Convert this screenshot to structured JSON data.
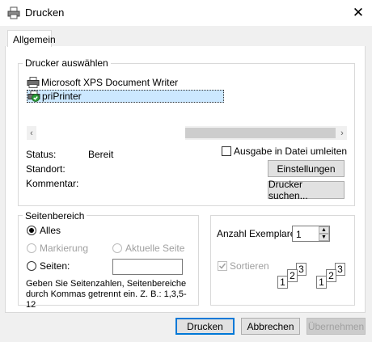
{
  "window": {
    "title": "Drucken",
    "close_glyph": "✕",
    "icon": "printer-icon"
  },
  "tabs": [
    {
      "label": "Allgemein"
    }
  ],
  "printer_group": {
    "label": "Drucker auswählen",
    "printers": [
      {
        "name": "Microsoft XPS Document Writer",
        "icon": "printer-icon",
        "selected": false
      },
      {
        "name": "priPrinter",
        "icon": "default-printer-icon",
        "selected": true
      }
    ],
    "scroll_left": "‹",
    "scroll_right": "›",
    "status_label": "Status:",
    "status_value": "Bereit",
    "location_label": "Standort:",
    "comment_label": "Kommentar:",
    "print_to_file_label": "Ausgabe in Datei umleiten",
    "print_to_file_checked": false,
    "preferences_button": "Einstellungen",
    "find_printer_button": "Drucker suchen..."
  },
  "page_range": {
    "label": "Seitenbereich",
    "all_label": "Alles",
    "selection_label": "Markierung",
    "current_page_label": "Aktuelle Seite",
    "pages_label": "Seiten:",
    "pages_value": "",
    "hint": "Geben Sie Seitenzahlen, Seitenbereiche durch Kommas getrennt ein. Z. B.: 1,3,5-12",
    "selected_option": "all"
  },
  "copies": {
    "label": "Anzahl Exemplare:",
    "value": "1",
    "collate_label": "Sortieren",
    "collate_checked": true,
    "up_glyph": "▲",
    "down_glyph": "▼",
    "collate_icon": "collate-pages-icon",
    "sheet_numbers": [
      "1",
      "2",
      "3"
    ]
  },
  "footer": {
    "print_button": "Drucken",
    "cancel_button": "Abbrechen",
    "apply_button": "Übernehmen"
  },
  "colors": {
    "selection_bg": "#cce8ff",
    "default_button_border": "#0078d7",
    "dialog_bg": "#f0f0f0"
  }
}
